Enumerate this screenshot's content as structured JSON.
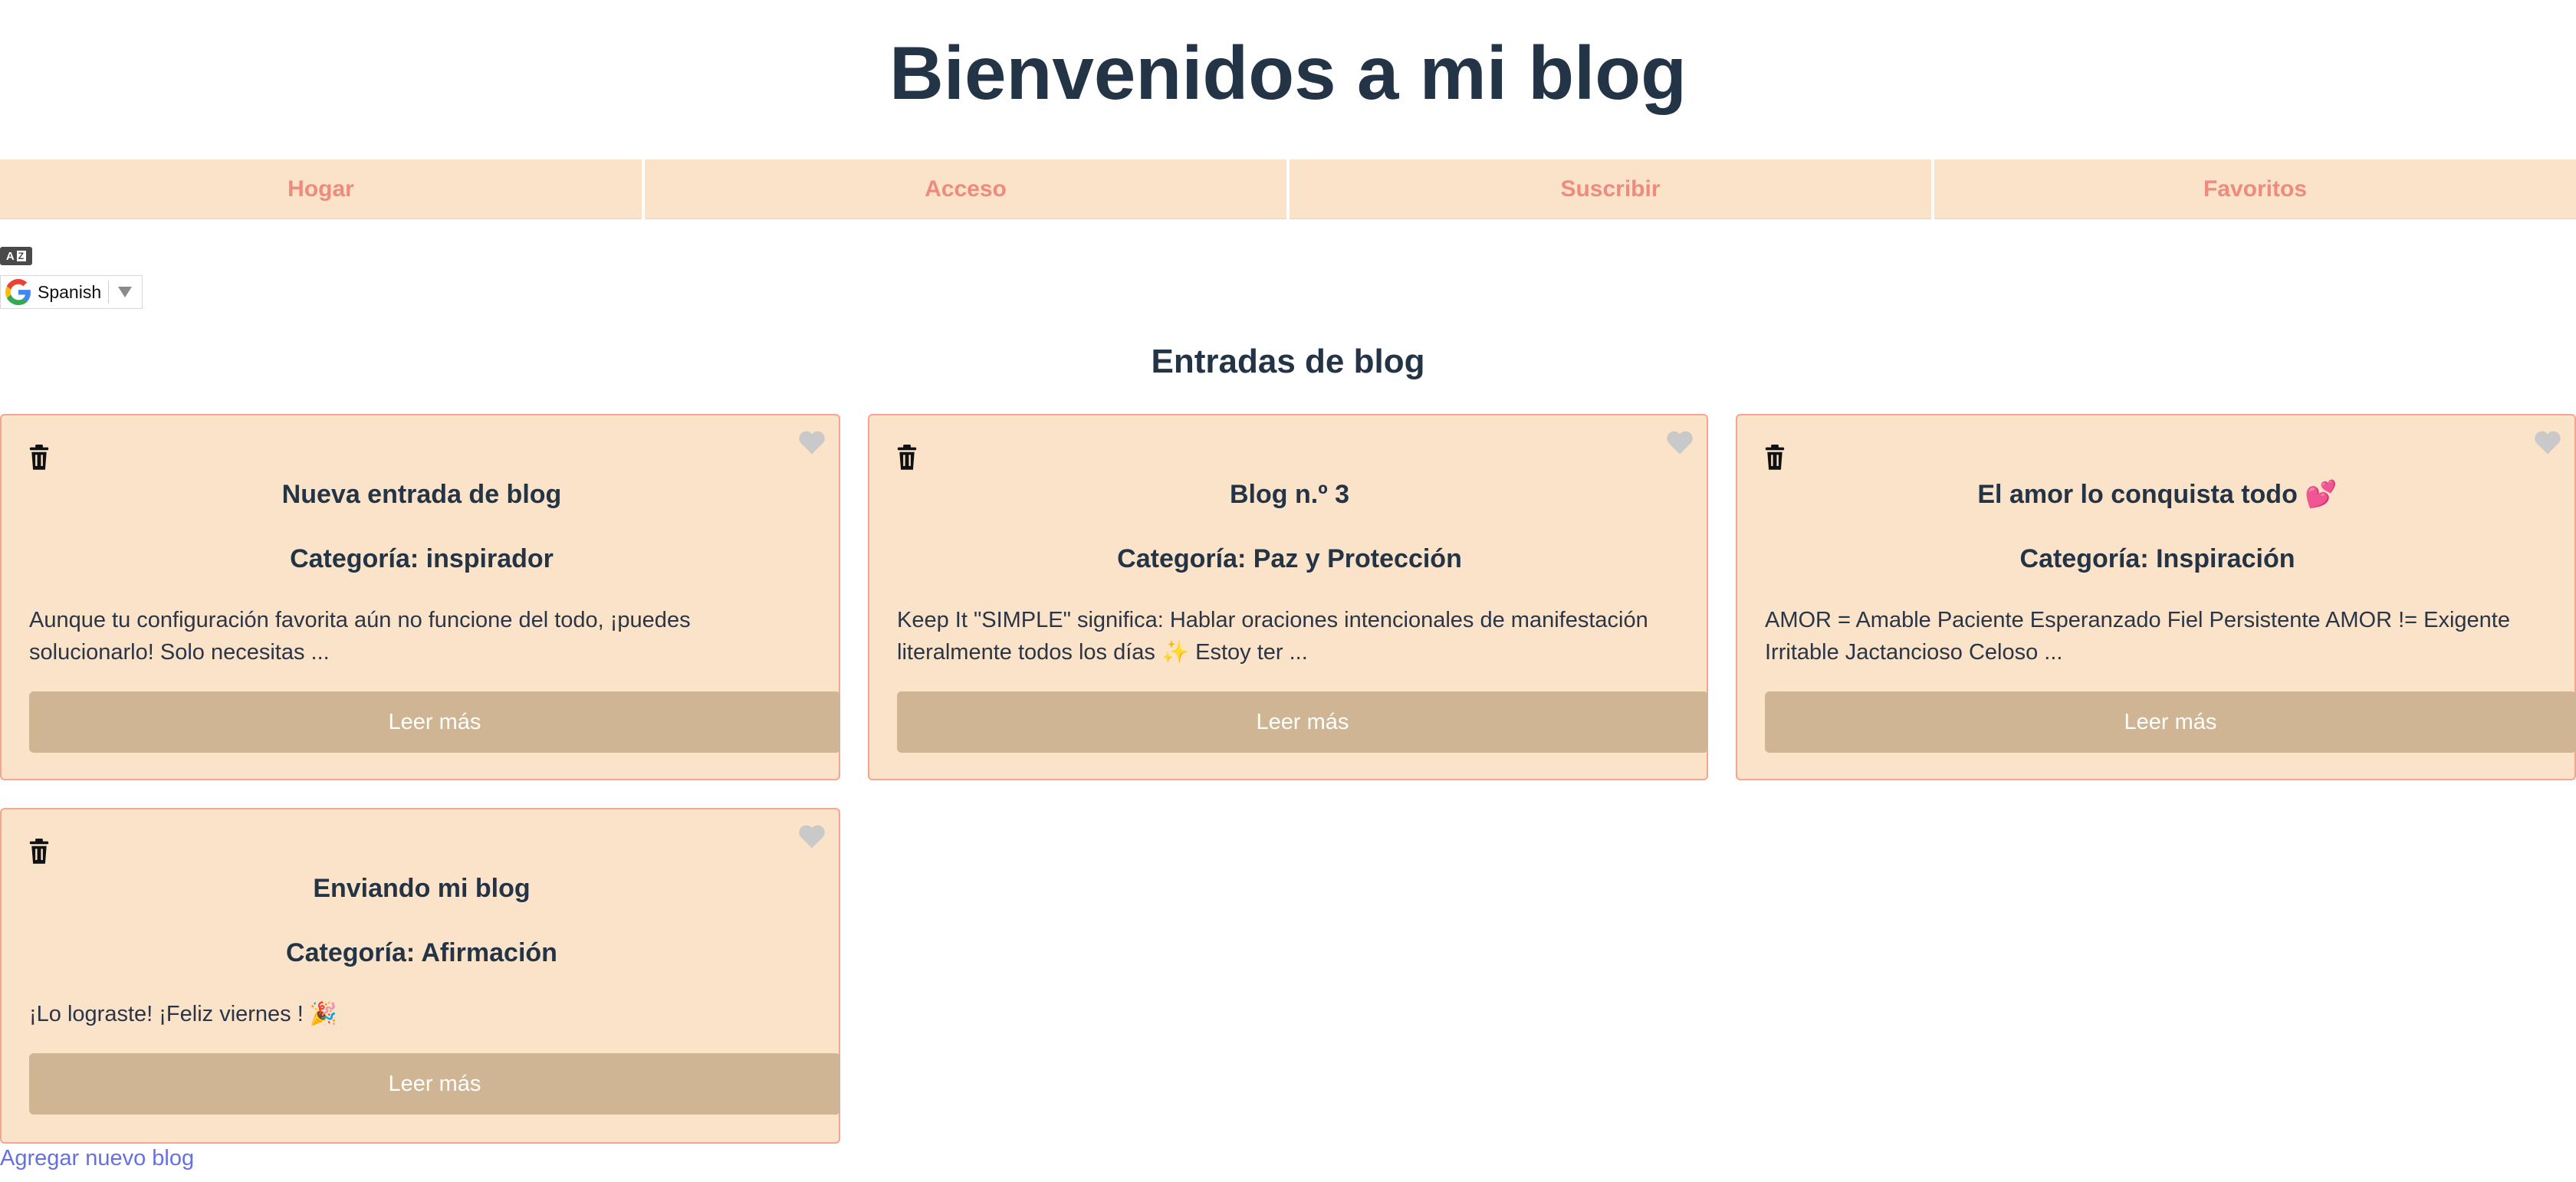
{
  "page": {
    "title": "Bienvenidos a mi blog"
  },
  "nav": {
    "items": [
      {
        "label": "Hogar"
      },
      {
        "label": "Acceso"
      },
      {
        "label": "Suscribir"
      },
      {
        "label": "Favoritos"
      }
    ]
  },
  "translate": {
    "language": "Spanish",
    "icon": "translate-icon",
    "logo": "google-g-logo"
  },
  "section": {
    "title": "Entradas de blog"
  },
  "posts": [
    {
      "title": "Nueva entrada de blog",
      "category": "Categoría: inspirador",
      "excerpt": "Aunque tu configuración favorita aún no funcione del todo, ¡puedes solucionarlo! Solo necesitas ...",
      "button": "Leer más"
    },
    {
      "title": "Blog n.º 3",
      "category": "Categoría: Paz y Protección",
      "excerpt": "Keep It \"SIMPLE\" significa: Hablar oraciones intencionales de manifestación literalmente todos los días ✨ Estoy ter ...",
      "button": "Leer más"
    },
    {
      "title": "El amor lo conquista todo 💕",
      "category": "Categoría: Inspiración",
      "excerpt": "AMOR = Amable Paciente Esperanzado Fiel Persistente AMOR != Exigente Irritable Jactancioso Celoso ...",
      "button": "Leer más"
    },
    {
      "title": "Enviando mi blog",
      "category": "Categoría: Afirmación",
      "excerpt": "¡Lo lograste! ¡Feliz viernes ! 🎉",
      "button": "Leer más"
    }
  ],
  "footer": {
    "add_link": "Agregar nuevo blog"
  },
  "colors": {
    "nav_bg": "#fae3c8",
    "nav_text": "#ef8a7f",
    "card_bg": "#fae3c8",
    "card_border": "#f4a591",
    "button_bg": "#cfb593",
    "link": "#6670e6",
    "heading": "#243447"
  },
  "icons": {
    "delete": "trash-icon",
    "favorite": "heart-icon"
  }
}
